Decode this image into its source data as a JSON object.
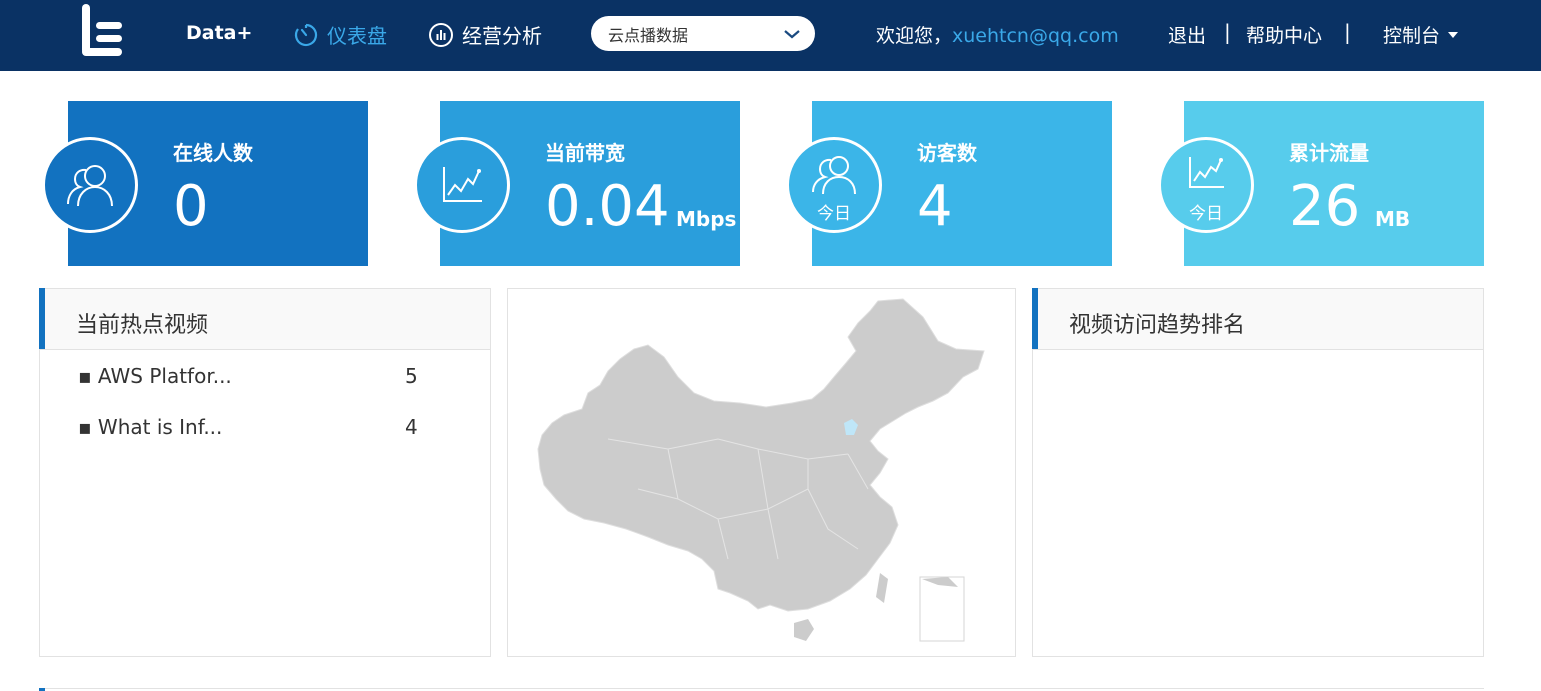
{
  "nav": {
    "brand": "Data+",
    "dashboard": "仪表盘",
    "analysis": "经营分析",
    "select_value": "云点播数据",
    "welcome": "欢迎您，",
    "email": "xuehtcn@qq.com",
    "logout": "退出",
    "separator": "|",
    "help": "帮助中心",
    "console": "控制台"
  },
  "cards": [
    {
      "label": "在线人数",
      "value": "0",
      "unit": "",
      "icon": "users-icon",
      "today": ""
    },
    {
      "label": "当前带宽",
      "value": "0.04",
      "unit": "Mbps",
      "icon": "line-chart-icon",
      "today": ""
    },
    {
      "label": "访客数",
      "value": "4",
      "unit": "",
      "icon": "users-icon",
      "today": "今日"
    },
    {
      "label": "累计流量",
      "value": "26",
      "unit": "MB",
      "icon": "line-chart-icon",
      "today": "今日"
    }
  ],
  "hot_videos": {
    "title": "当前热点视频",
    "items": [
      {
        "name": "▪ AWS Platfor...",
        "count": "5"
      },
      {
        "name": "▪ What is Inf...",
        "count": "4"
      }
    ]
  },
  "trend": {
    "title": "视频访问趋势排名"
  },
  "colors": {
    "nav_bg": "#0a3264",
    "accent": "#3aa8e8",
    "card1": "#1272c0",
    "card2": "#2a9edc",
    "card3": "#3bb5e8",
    "card4": "#57ccec",
    "map_fill": "#cccccc",
    "map_highlight": "#bfe6f8"
  }
}
